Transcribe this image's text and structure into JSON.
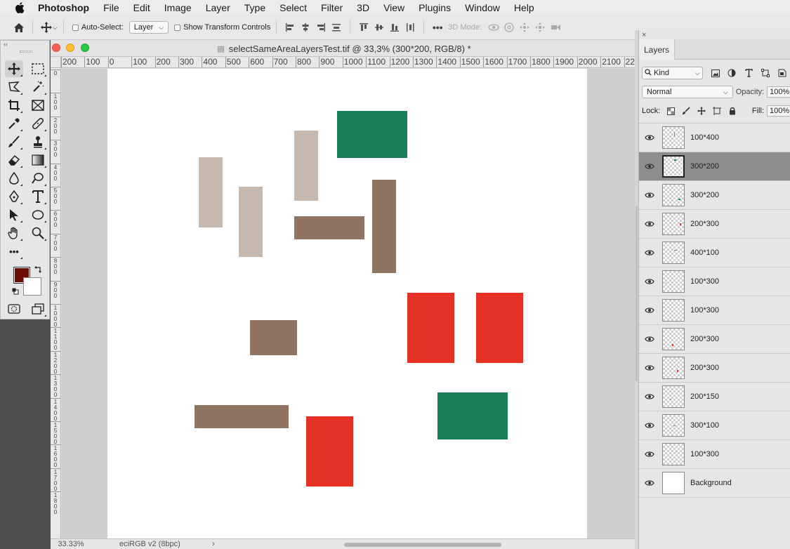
{
  "menubar": {
    "app_name": "Photoshop",
    "items": [
      "File",
      "Edit",
      "Image",
      "Layer",
      "Type",
      "Select",
      "Filter",
      "3D",
      "View",
      "Plugins",
      "Window",
      "Help"
    ]
  },
  "options_bar": {
    "auto_select_label": "Auto-Select:",
    "auto_select_target": "Layer",
    "show_transform_label": "Show Transform Controls",
    "mode_3d_label": "3D Mode:"
  },
  "document": {
    "title": "selectSameAreaLayersTest.tif @ 33,3% (300*200, RGB/8) *",
    "zoom": "33.33%",
    "profile": "eciRGB v2 (8bpc)",
    "status_arrow": "›",
    "ruler_h_labels": [
      "200",
      "100",
      "0",
      "100",
      "200",
      "300",
      "400",
      "500",
      "600",
      "700",
      "800",
      "900",
      "1000",
      "1100",
      "1200",
      "1300",
      "1400",
      "1500",
      "1600",
      "1700",
      "1800",
      "1900",
      "2000",
      "2100",
      "22"
    ],
    "ruler_v_labels": [
      "0",
      "100",
      "200",
      "300",
      "400",
      "500",
      "600",
      "700",
      "800",
      "900",
      "1000",
      "1100",
      "1200",
      "1300",
      "1400",
      "1500",
      "1600",
      "1700",
      "1800"
    ]
  },
  "canvas_shapes": [
    {
      "layer": "100*300",
      "color": "#c7b8ad"
    },
    {
      "layer": "100*300",
      "color": "#c7b8ad"
    },
    {
      "layer": "100*300",
      "color": "#c7b8ad"
    },
    {
      "layer": "300*200",
      "color": "#1a7f57"
    },
    {
      "layer": "300*100",
      "color": "#8f7363"
    },
    {
      "layer": "100*400",
      "color": "#8f7363"
    },
    {
      "layer": "200*300",
      "color": "#e53026"
    },
    {
      "layer": "200*300",
      "color": "#e53026"
    },
    {
      "layer": "200*150",
      "color": "#8f7363"
    },
    {
      "layer": "400*100",
      "color": "#8f7363"
    },
    {
      "layer": "200*300",
      "color": "#e53026"
    },
    {
      "layer": "300*200",
      "color": "#1a7f57"
    }
  ],
  "tools_panel": {
    "collapse_label": "‹‹",
    "foreground_color": "#6b0f05",
    "background_color": "#ffffff",
    "tools": [
      "move-tool-icon",
      "marquee-tool-icon",
      "lasso-tool-icon",
      "magic-wand-tool-icon",
      "crop-tool-icon",
      "frame-tool-icon",
      "eyedropper-tool-icon",
      "healing-brush-tool-icon",
      "brush-tool-icon",
      "clone-stamp-tool-icon",
      "eraser-tool-icon",
      "gradient-tool-icon",
      "blur-tool-icon",
      "dodge-tool-icon",
      "pen-tool-icon",
      "type-tool-icon",
      "path-selection-tool-icon",
      "ellipse-tool-icon",
      "hand-tool-icon",
      "zoom-tool-icon"
    ],
    "more_label": "•••"
  },
  "layers_panel": {
    "tab_label": "Layers",
    "close_label": "×",
    "filter_kind": "Kind",
    "blend_mode": "Normal",
    "opacity_label": "Opacity:",
    "opacity_value": "100%",
    "lock_label": "Lock:",
    "fill_label": "Fill:",
    "fill_value": "100%",
    "layers": [
      {
        "name": "100*400",
        "selected": false
      },
      {
        "name": "300*200",
        "selected": true
      },
      {
        "name": "300*200",
        "selected": false
      },
      {
        "name": "200*300",
        "selected": false
      },
      {
        "name": "400*100",
        "selected": false
      },
      {
        "name": "100*300",
        "selected": false
      },
      {
        "name": "100*300",
        "selected": false
      },
      {
        "name": "200*300",
        "selected": false
      },
      {
        "name": "200*300",
        "selected": false
      },
      {
        "name": "200*150",
        "selected": false
      },
      {
        "name": "300*100",
        "selected": false
      },
      {
        "name": "100*300",
        "selected": false
      },
      {
        "name": "Background",
        "selected": false
      }
    ]
  },
  "colors": {
    "accent_green": "#1a7f57",
    "accent_red": "#e53026",
    "accent_brown": "#8f7363",
    "accent_beige": "#c7b8ad",
    "selected_row": "#8e8e8e"
  }
}
